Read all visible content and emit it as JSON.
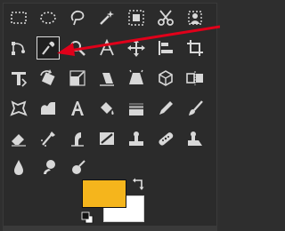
{
  "toolbox": {
    "rows": [
      [
        "rect-select-icon",
        "ellipse-select-icon",
        "free-select-icon",
        "fuzzy-select-icon",
        "select-by-color-icon",
        "scissors-select-icon",
        "foreground-select-icon"
      ],
      [
        "paths-icon",
        "color-picker-icon",
        "zoom-icon",
        "measure-icon",
        "move-icon",
        "align-icon",
        "crop-icon"
      ],
      [
        "unified-transform-icon",
        "rotate-icon",
        "scale-icon",
        "shear-icon",
        "perspective-icon",
        "3d-transform-icon",
        "flip-icon"
      ],
      [
        "cage-transform-icon",
        "warp-transform-icon",
        "text-icon",
        "bucket-fill-icon",
        "blend-gradient-icon",
        "pencil-icon",
        "paintbrush-icon"
      ],
      [
        "eraser-icon",
        "airbrush-icon",
        "ink-icon",
        "mypaint-brush-icon",
        "clone-icon",
        "heal-icon",
        "perspective-clone-icon"
      ],
      [
        "blur-sharpen-icon",
        "smudge-icon",
        "dodge-burn-icon"
      ]
    ],
    "active_tool": "color-picker-icon"
  },
  "colors": {
    "foreground": "#f5b51c",
    "background": "#ffffff",
    "annotation_arrow": "#e0001a",
    "icon": "#d8d8d8"
  }
}
